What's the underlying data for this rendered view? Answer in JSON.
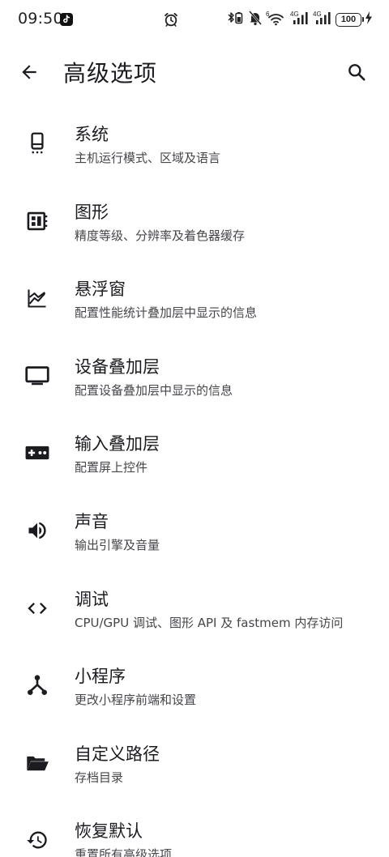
{
  "status_bar": {
    "time": "09:50",
    "battery": "100"
  },
  "app_bar": {
    "title": "高级选项"
  },
  "settings": [
    {
      "title": "系统",
      "subtitle": "主机运行模式、区域及语言",
      "icon": "phone-icon"
    },
    {
      "title": "图形",
      "subtitle": "精度等级、分辨率及着色器缓存",
      "icon": "chip-icon"
    },
    {
      "title": "悬浮窗",
      "subtitle": "配置性能统计叠加层中显示的信息",
      "icon": "chart-icon"
    },
    {
      "title": "设备叠加层",
      "subtitle": "配置设备叠加层中显示的信息",
      "icon": "monitor-icon"
    },
    {
      "title": "输入叠加层",
      "subtitle": "配置屏上控件",
      "icon": "gamepad-icon"
    },
    {
      "title": "声音",
      "subtitle": "输出引擎及音量",
      "icon": "speaker-icon"
    },
    {
      "title": "调试",
      "subtitle": "CPU/GPU 调试、图形 API 及 fastmem 内存访问",
      "icon": "code-icon"
    },
    {
      "title": "小程序",
      "subtitle": "更改小程序前端和设置",
      "icon": "hub-icon"
    },
    {
      "title": "自定义路径",
      "subtitle": "存档目录",
      "icon": "folder-icon"
    },
    {
      "title": "恢复默认",
      "subtitle": "重置所有高级选项",
      "icon": "restore-icon"
    }
  ]
}
